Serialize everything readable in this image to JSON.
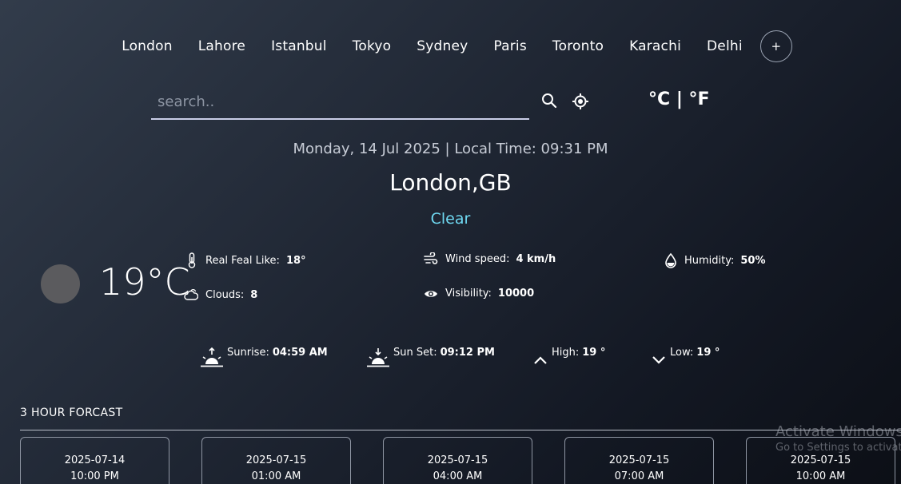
{
  "cities": [
    "London",
    "Lahore",
    "Istanbul",
    "Tokyo",
    "Sydney",
    "Paris",
    "Toronto",
    "Karachi",
    "Delhi"
  ],
  "add_label": "+",
  "search": {
    "placeholder": "search.."
  },
  "units": {
    "celsius": "°C",
    "separator": " | ",
    "fahrenheit": "°F"
  },
  "datetime": "Monday, 14 Jul 2025 | Local Time: 09:31 PM",
  "city": "London,GB",
  "condition": "Clear",
  "temperature": "19°C",
  "details": {
    "feels_like": {
      "label": "Real Feal Like:",
      "value": "18°"
    },
    "wind": {
      "label": "Wind speed:",
      "value": "4 km/h"
    },
    "humidity": {
      "label": "Humidity:",
      "value": "50%"
    },
    "clouds": {
      "label": "Clouds:",
      "value": "8"
    },
    "visibility": {
      "label": "Visibility:",
      "value": "10000"
    }
  },
  "sun": {
    "sunrise": {
      "label": "Sunrise:",
      "value": "04:59 AM"
    },
    "sunset": {
      "label": "Sun Set:",
      "value": "09:12 PM"
    },
    "high": {
      "label": "High:",
      "value": "19 °"
    },
    "low": {
      "label": "Low:",
      "value": "19 °"
    }
  },
  "forecast": {
    "title": "3 HOUR FORCAST",
    "cards": [
      {
        "date": "2025-07-14",
        "time": "10:00 PM"
      },
      {
        "date": "2025-07-15",
        "time": "01:00 AM"
      },
      {
        "date": "2025-07-15",
        "time": "04:00 AM"
      },
      {
        "date": "2025-07-15",
        "time": "07:00 AM"
      },
      {
        "date": "2025-07-15",
        "time": "10:00 AM"
      }
    ]
  },
  "watermark": {
    "line1": "Activate Windows",
    "line2": "Go to Settings to activate Windows."
  },
  "icons": [
    "search-icon",
    "location-icon",
    "weather-icon",
    "thermometer-icon",
    "wind-icon",
    "humidity-icon",
    "cloud-icon",
    "eye-icon",
    "sunrise-icon",
    "sunset-icon",
    "chevron-up-icon",
    "chevron-down-icon"
  ],
  "colors": {
    "condition": "#6fd9f2",
    "background_start": "#323c4b",
    "background_end": "#0c0f16"
  }
}
